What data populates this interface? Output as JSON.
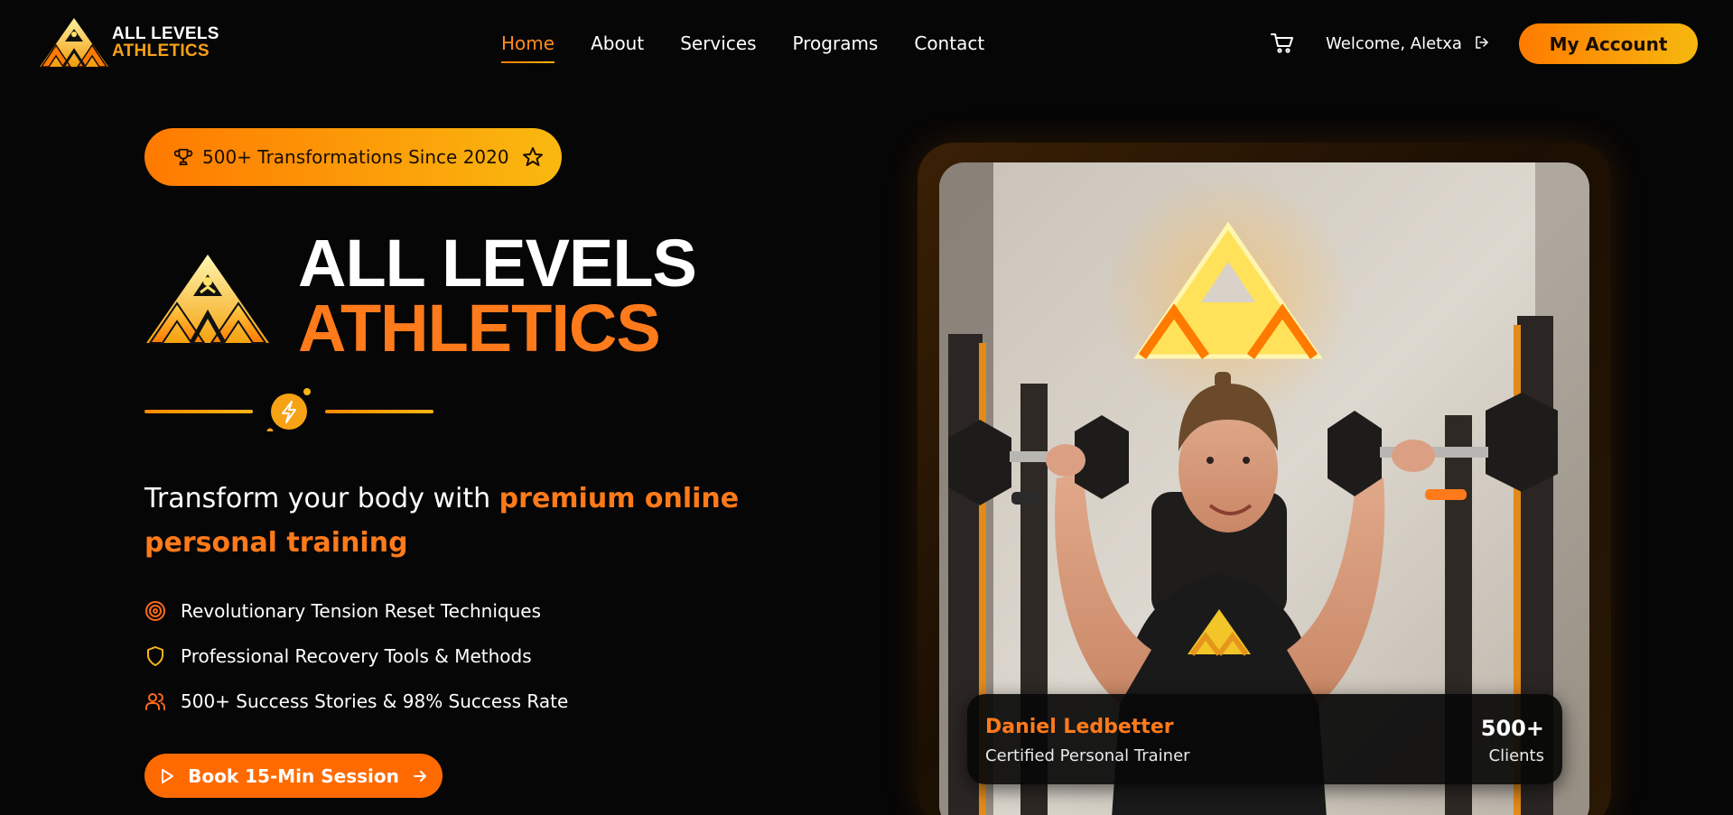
{
  "header": {
    "brand": {
      "line1": "ALL LEVELS",
      "line2": "ATHLETICS",
      "logo_icon": "ava-triangle-logo"
    },
    "nav": [
      {
        "label": "Home",
        "active": true
      },
      {
        "label": "About",
        "active": false
      },
      {
        "label": "Services",
        "active": false
      },
      {
        "label": "Programs",
        "active": false
      },
      {
        "label": "Contact",
        "active": false
      }
    ],
    "cart_icon": "cart-icon",
    "welcome_text": "Welcome, Aletxa",
    "logout_icon": "logout-icon",
    "account_button": "My Account"
  },
  "hero": {
    "badge": {
      "text": "500+ Transformations Since 2020",
      "left_icon": "trophy-icon",
      "right_icon": "star-icon"
    },
    "title_line1": "ALL LEVELS",
    "title_line2": "ATHLETICS",
    "divider_icon": "lightning-icon",
    "tagline_plain": "Transform your body with ",
    "tagline_highlight": "premium online personal training",
    "features": [
      {
        "icon": "target-icon",
        "text": "Revolutionary Tension Reset Techniques"
      },
      {
        "icon": "shield-icon",
        "text": "Professional Recovery Tools & Methods"
      },
      {
        "icon": "users-icon",
        "text": "500+ Success Stories & 98% Success Rate"
      }
    ],
    "cta": {
      "label": "Book 15-Min Session",
      "left_icon": "play-icon",
      "right_icon": "arrow-right-icon"
    }
  },
  "trainer_card": {
    "name": "Daniel Ledbetter",
    "role": "Certified Personal Trainer",
    "count": "500+",
    "count_label": "Clients"
  },
  "colors": {
    "accent_orange": "#ff7a1a",
    "accent_gold": "#f6b80f",
    "background": "#060606"
  }
}
